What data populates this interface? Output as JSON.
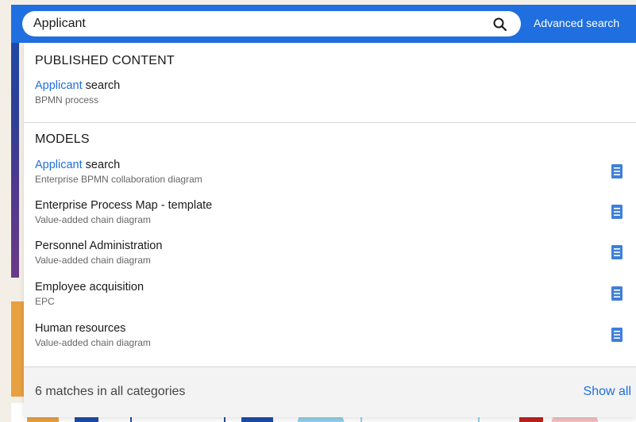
{
  "search": {
    "value": "Applicant",
    "advanced_label": "Advanced search"
  },
  "published": {
    "heading": "PUBLISHED CONTENT",
    "items": [
      {
        "highlight": "Applicant",
        "rest": " search",
        "type": "BPMN process"
      }
    ]
  },
  "models": {
    "heading": "MODELS",
    "items": [
      {
        "highlight": "Applicant",
        "rest": " search",
        "type": "Enterprise BPMN collaboration diagram",
        "icon": "model-file-icon"
      },
      {
        "highlight": "",
        "rest": "Enterprise Process Map - template",
        "type": "Value-added chain diagram",
        "icon": "model-file-icon"
      },
      {
        "highlight": "",
        "rest": "Personnel Administration",
        "type": "Value-added chain diagram",
        "icon": "model-file-icon"
      },
      {
        "highlight": "",
        "rest": "Employee acquisition",
        "type": "EPC",
        "icon": "model-file-icon"
      },
      {
        "highlight": "",
        "rest": "Human resources",
        "type": "Value-added chain diagram",
        "icon": "model-file-icon"
      }
    ]
  },
  "footer": {
    "count_text": "6 matches in all categories",
    "show_all_label": "Show all"
  },
  "colors": {
    "accent": "#1f6fe0",
    "icon": "#3f7fd9"
  }
}
